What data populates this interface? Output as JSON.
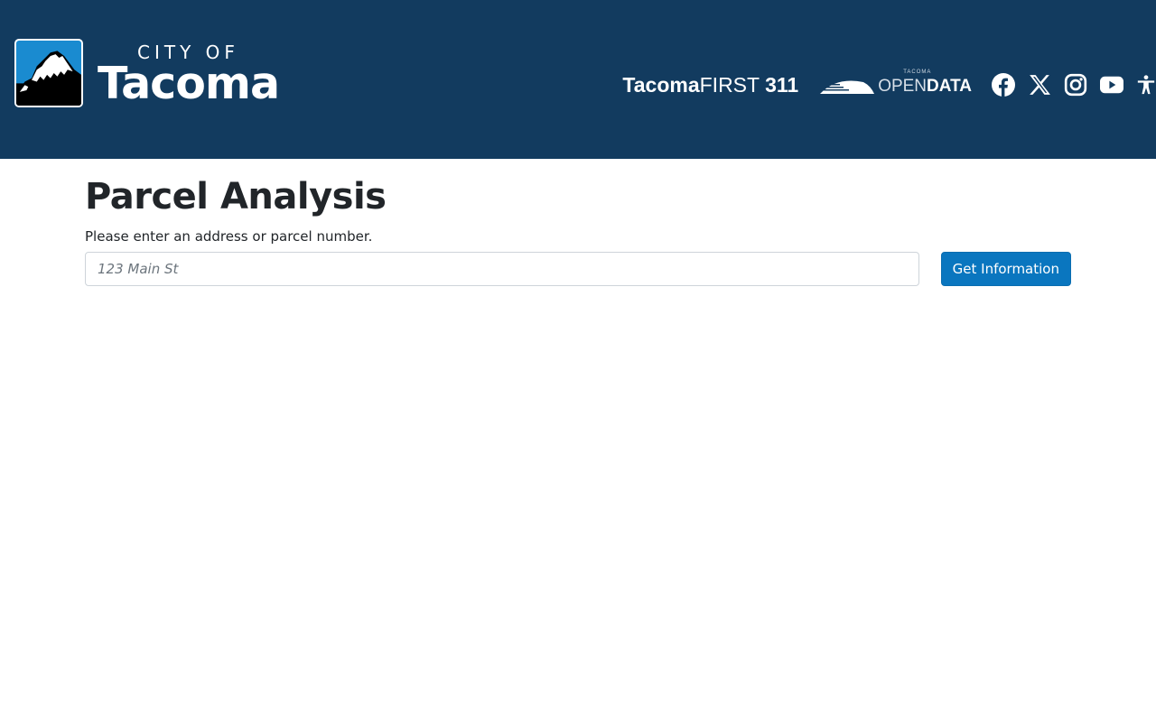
{
  "header": {
    "logo": {
      "city_of": "CITY OF",
      "name": "Tacoma"
    },
    "links": {
      "tacoma_first_part1": "Tacoma",
      "tacoma_first_part2": "FIRST",
      "tacoma_first_part3": "311",
      "open_data_small": "TACOMA",
      "open_data_open": "OPEN",
      "open_data_data": "DATA"
    },
    "social": [
      "facebook-icon",
      "x-icon",
      "instagram-icon",
      "youtube-icon",
      "accessibility-icon"
    ]
  },
  "main": {
    "title": "Parcel Analysis",
    "prompt": "Please enter an address or parcel number.",
    "search_placeholder": "123 Main St",
    "search_value": "",
    "button_label": "Get Information"
  },
  "colors": {
    "header_bg": "#123b5f",
    "button_bg": "#0a76bf"
  }
}
